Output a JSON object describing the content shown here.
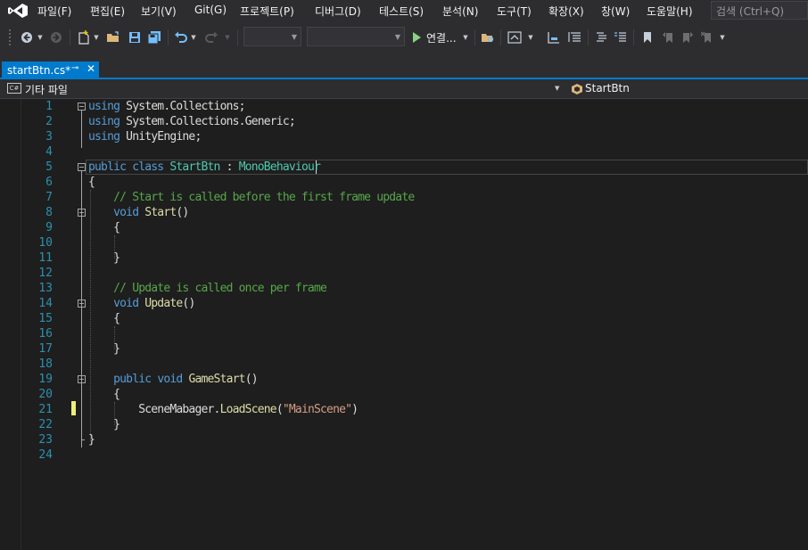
{
  "menu": {
    "items": [
      "파일(F)",
      "편집(E)",
      "보기(V)",
      "Git(G)",
      "프로젝트(P)",
      "디버그(D)",
      "테스트(S)",
      "분석(N)",
      "도구(T)",
      "확장(X)",
      "창(W)",
      "도움말(H)"
    ],
    "search_placeholder": "검색 (Ctrl+Q)"
  },
  "toolbar": {
    "run_label": "연결..."
  },
  "tab": {
    "label": "startBtn.cs*"
  },
  "navbar": {
    "project": "기타 파일",
    "member": "StartBtn"
  },
  "editor": {
    "line_numbers": [
      "1",
      "2",
      "3",
      "4",
      "5",
      "6",
      "7",
      "8",
      "9",
      "10",
      "11",
      "12",
      "13",
      "14",
      "15",
      "16",
      "17",
      "18",
      "19",
      "20",
      "21",
      "22",
      "23",
      "24"
    ],
    "lines": {
      "l1": {
        "kw": "using",
        "rest": " System.Collections;"
      },
      "l2": {
        "kw": "using",
        "rest": " System.Collections.Generic;"
      },
      "l3": {
        "kw": "using",
        "rest": " UnityEngine;"
      },
      "l5": {
        "kw1": "public",
        "kw2": "class",
        "name": "StartBtn",
        "sep": " : ",
        "base": "MonoBehaviour"
      },
      "l6": "{",
      "l7": "// Start is called before the first frame update",
      "l8": {
        "kw": "void",
        "fn": "Start",
        "rest": "()"
      },
      "l9": "{",
      "l11": "}",
      "l13": "// Update is called once per frame",
      "l14": {
        "kw": "void",
        "fn": "Update",
        "rest": "()"
      },
      "l15": "{",
      "l17": "}",
      "l19": {
        "kw1": "public",
        "kw2": "void",
        "fn": "GameStart",
        "rest": "()"
      },
      "l20": "{",
      "l21": {
        "obj": "SceneMabager",
        "dot": ".",
        "fn": "LoadScene",
        "open": "(",
        "str": "\"MainScene\"",
        "close": ")"
      },
      "l22": "}",
      "l23": "}"
    }
  },
  "colors": {
    "keyword": "#569cd6",
    "type": "#4ec9b0",
    "comment": "#57a64a",
    "string": "#d69d85",
    "line_number": "#2b91af",
    "accent": "#007acc"
  }
}
